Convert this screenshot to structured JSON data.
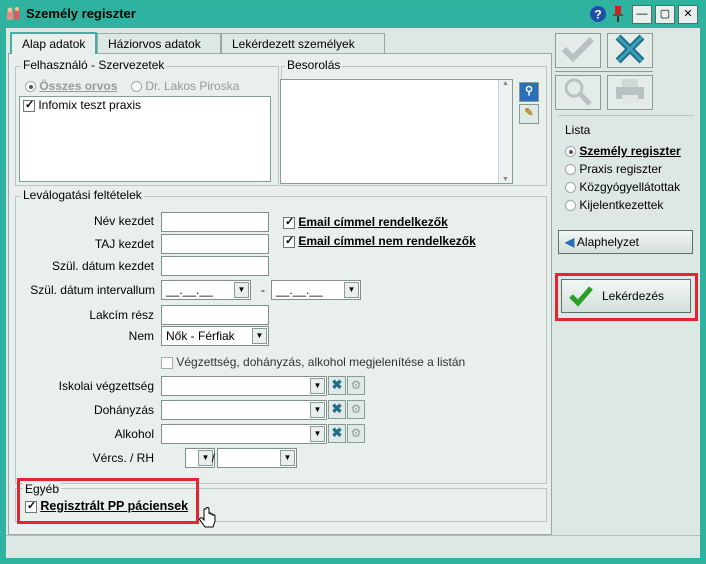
{
  "window": {
    "title": "Személy regiszter",
    "app_icon": "app-icon",
    "help_icon": "help-icon",
    "pin_icon": "pin-icon",
    "minimize_icon": "minimize-icon",
    "restore_icon": "restore-icon",
    "close_icon": "close-icon"
  },
  "tabs": [
    {
      "label": "Alap adatok"
    },
    {
      "label": "Háziorvos adatok"
    },
    {
      "label": "Lekérdezett személyek"
    }
  ],
  "user_org": {
    "title": "Felhasználó - Szervezetek",
    "radio_all": "Összes orvos",
    "radio_doctor": "Dr. Lakos Piroska",
    "items": [
      "Infomix teszt praxis"
    ]
  },
  "classification": {
    "title": "Besorolás"
  },
  "filters": {
    "title": "Leválogatási feltételek",
    "name_label": "Név kezdet",
    "taj_label": "TAJ kezdet",
    "dob_start_label": "Szül. dátum kezdet",
    "dob_range_label": "Szül. dátum intervallum",
    "date_placeholder": "__.__.__",
    "range_sep": "-",
    "address_label": "Lakcím rész",
    "sex_label": "Nem",
    "sex_value": "Nők - Férfiak",
    "email_with": "Email címmel rendelkezők",
    "email_without": "Email címmel nem rendelkezők",
    "show_details_label": "Végzettség, dohányzás, alkohol megjelenítése a listán",
    "education_label": "Iskolai végzettség",
    "smoking_label": "Dohányzás",
    "alcohol_label": "Alkohol",
    "blood_label": "Vércs. / RH",
    "blood_sep": "/"
  },
  "other": {
    "title": "Egyéb",
    "registered_label": "Regisztrált PP páciensek"
  },
  "right": {
    "list_title": "Lista",
    "list_options": [
      "Személy regiszter",
      "Praxis regiszter",
      "Közgyógyellátottak",
      "Kijelentkezettek"
    ],
    "reset_label": "Alaphelyzet",
    "query_label": "Lekérdezés"
  },
  "colors": {
    "accent": "#2fb3a0",
    "highlight": "#e2262f",
    "link": "#1e6f8a"
  }
}
